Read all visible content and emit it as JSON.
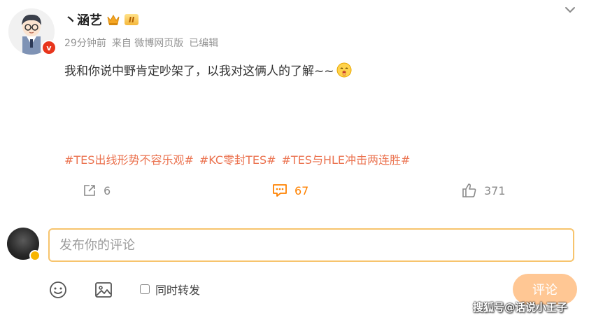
{
  "post": {
    "username": "丶涵艺",
    "level": "II",
    "meta": {
      "time": "29分钟前",
      "source": "来自 微博网页版",
      "edited": "已编辑"
    },
    "content": "我和你说中野肯定吵架了，以我对这俩人的了解~~",
    "emoji": "shush-face-icon",
    "topics": [
      "#TES出线形势不容乐观#",
      "#KC零封TES#",
      "#TES与HLE冲击两连胜#"
    ]
  },
  "actions": {
    "repost_count": "6",
    "comment_count": "67",
    "like_count": "371"
  },
  "compose": {
    "placeholder": "发布你的评论",
    "repost_label": "同时转发",
    "submit_label": "评论"
  },
  "watermark": "搜狐号@话说小王子",
  "colors": {
    "accent": "#ff8200",
    "topic": "#eb7350",
    "input_border": "#f7c46d",
    "submit_bg": "#ffc794",
    "verified": "#e8351c"
  }
}
